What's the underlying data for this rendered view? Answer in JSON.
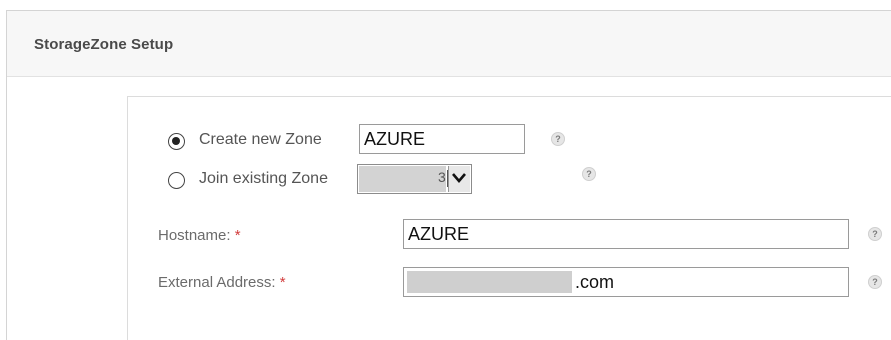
{
  "header": {
    "title": "StorageZone Setup"
  },
  "zone": {
    "create_label": "Create new Zone",
    "create_value": "AZURE",
    "join_label": "Join existing Zone",
    "join_selected_visible": "3",
    "selected_option": "create"
  },
  "fields": {
    "hostname_label": "Hostname:",
    "hostname_value": "AZURE",
    "external_label": "External Address:",
    "external_suffix": ".com",
    "required_marker": "*"
  },
  "help": {
    "glyph": "?"
  },
  "icons": [
    "radio-checked-icon",
    "radio-unchecked-icon",
    "help-icon",
    "chevron-down-icon"
  ],
  "colors": {
    "required": "#d23b3b",
    "header_bg": "#f7f7f7",
    "masked": "#cfcfcf"
  }
}
